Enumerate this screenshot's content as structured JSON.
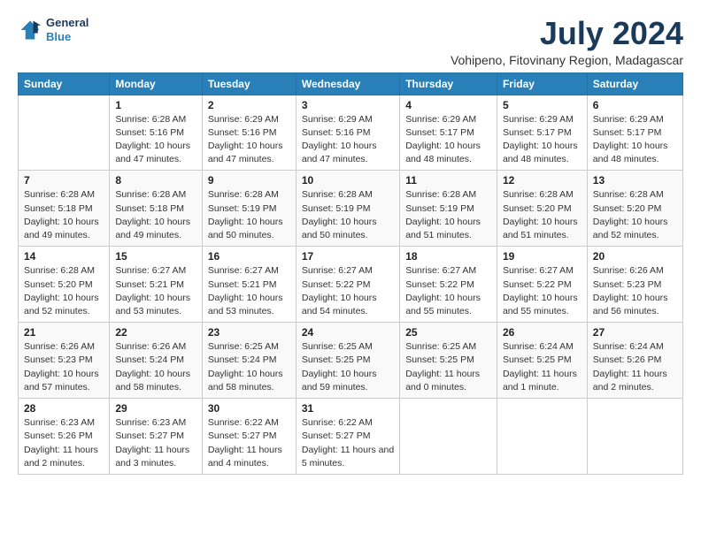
{
  "logo": {
    "line1": "General",
    "line2": "Blue"
  },
  "title": "July 2024",
  "subtitle": "Vohipeno, Fitovinany Region, Madagascar",
  "header_days": [
    "Sunday",
    "Monday",
    "Tuesday",
    "Wednesday",
    "Thursday",
    "Friday",
    "Saturday"
  ],
  "weeks": [
    [
      {
        "day": "",
        "sunrise": "",
        "sunset": "",
        "daylight": ""
      },
      {
        "day": "1",
        "sunrise": "Sunrise: 6:28 AM",
        "sunset": "Sunset: 5:16 PM",
        "daylight": "Daylight: 10 hours and 47 minutes."
      },
      {
        "day": "2",
        "sunrise": "Sunrise: 6:29 AM",
        "sunset": "Sunset: 5:16 PM",
        "daylight": "Daylight: 10 hours and 47 minutes."
      },
      {
        "day": "3",
        "sunrise": "Sunrise: 6:29 AM",
        "sunset": "Sunset: 5:16 PM",
        "daylight": "Daylight: 10 hours and 47 minutes."
      },
      {
        "day": "4",
        "sunrise": "Sunrise: 6:29 AM",
        "sunset": "Sunset: 5:17 PM",
        "daylight": "Daylight: 10 hours and 48 minutes."
      },
      {
        "day": "5",
        "sunrise": "Sunrise: 6:29 AM",
        "sunset": "Sunset: 5:17 PM",
        "daylight": "Daylight: 10 hours and 48 minutes."
      },
      {
        "day": "6",
        "sunrise": "Sunrise: 6:29 AM",
        "sunset": "Sunset: 5:17 PM",
        "daylight": "Daylight: 10 hours and 48 minutes."
      }
    ],
    [
      {
        "day": "7",
        "sunrise": "Sunrise: 6:28 AM",
        "sunset": "Sunset: 5:18 PM",
        "daylight": "Daylight: 10 hours and 49 minutes."
      },
      {
        "day": "8",
        "sunrise": "Sunrise: 6:28 AM",
        "sunset": "Sunset: 5:18 PM",
        "daylight": "Daylight: 10 hours and 49 minutes."
      },
      {
        "day": "9",
        "sunrise": "Sunrise: 6:28 AM",
        "sunset": "Sunset: 5:19 PM",
        "daylight": "Daylight: 10 hours and 50 minutes."
      },
      {
        "day": "10",
        "sunrise": "Sunrise: 6:28 AM",
        "sunset": "Sunset: 5:19 PM",
        "daylight": "Daylight: 10 hours and 50 minutes."
      },
      {
        "day": "11",
        "sunrise": "Sunrise: 6:28 AM",
        "sunset": "Sunset: 5:19 PM",
        "daylight": "Daylight: 10 hours and 51 minutes."
      },
      {
        "day": "12",
        "sunrise": "Sunrise: 6:28 AM",
        "sunset": "Sunset: 5:20 PM",
        "daylight": "Daylight: 10 hours and 51 minutes."
      },
      {
        "day": "13",
        "sunrise": "Sunrise: 6:28 AM",
        "sunset": "Sunset: 5:20 PM",
        "daylight": "Daylight: 10 hours and 52 minutes."
      }
    ],
    [
      {
        "day": "14",
        "sunrise": "Sunrise: 6:28 AM",
        "sunset": "Sunset: 5:20 PM",
        "daylight": "Daylight: 10 hours and 52 minutes."
      },
      {
        "day": "15",
        "sunrise": "Sunrise: 6:27 AM",
        "sunset": "Sunset: 5:21 PM",
        "daylight": "Daylight: 10 hours and 53 minutes."
      },
      {
        "day": "16",
        "sunrise": "Sunrise: 6:27 AM",
        "sunset": "Sunset: 5:21 PM",
        "daylight": "Daylight: 10 hours and 53 minutes."
      },
      {
        "day": "17",
        "sunrise": "Sunrise: 6:27 AM",
        "sunset": "Sunset: 5:22 PM",
        "daylight": "Daylight: 10 hours and 54 minutes."
      },
      {
        "day": "18",
        "sunrise": "Sunrise: 6:27 AM",
        "sunset": "Sunset: 5:22 PM",
        "daylight": "Daylight: 10 hours and 55 minutes."
      },
      {
        "day": "19",
        "sunrise": "Sunrise: 6:27 AM",
        "sunset": "Sunset: 5:22 PM",
        "daylight": "Daylight: 10 hours and 55 minutes."
      },
      {
        "day": "20",
        "sunrise": "Sunrise: 6:26 AM",
        "sunset": "Sunset: 5:23 PM",
        "daylight": "Daylight: 10 hours and 56 minutes."
      }
    ],
    [
      {
        "day": "21",
        "sunrise": "Sunrise: 6:26 AM",
        "sunset": "Sunset: 5:23 PM",
        "daylight": "Daylight: 10 hours and 57 minutes."
      },
      {
        "day": "22",
        "sunrise": "Sunrise: 6:26 AM",
        "sunset": "Sunset: 5:24 PM",
        "daylight": "Daylight: 10 hours and 58 minutes."
      },
      {
        "day": "23",
        "sunrise": "Sunrise: 6:25 AM",
        "sunset": "Sunset: 5:24 PM",
        "daylight": "Daylight: 10 hours and 58 minutes."
      },
      {
        "day": "24",
        "sunrise": "Sunrise: 6:25 AM",
        "sunset": "Sunset: 5:25 PM",
        "daylight": "Daylight: 10 hours and 59 minutes."
      },
      {
        "day": "25",
        "sunrise": "Sunrise: 6:25 AM",
        "sunset": "Sunset: 5:25 PM",
        "daylight": "Daylight: 11 hours and 0 minutes."
      },
      {
        "day": "26",
        "sunrise": "Sunrise: 6:24 AM",
        "sunset": "Sunset: 5:25 PM",
        "daylight": "Daylight: 11 hours and 1 minute."
      },
      {
        "day": "27",
        "sunrise": "Sunrise: 6:24 AM",
        "sunset": "Sunset: 5:26 PM",
        "daylight": "Daylight: 11 hours and 2 minutes."
      }
    ],
    [
      {
        "day": "28",
        "sunrise": "Sunrise: 6:23 AM",
        "sunset": "Sunset: 5:26 PM",
        "daylight": "Daylight: 11 hours and 2 minutes."
      },
      {
        "day": "29",
        "sunrise": "Sunrise: 6:23 AM",
        "sunset": "Sunset: 5:27 PM",
        "daylight": "Daylight: 11 hours and 3 minutes."
      },
      {
        "day": "30",
        "sunrise": "Sunrise: 6:22 AM",
        "sunset": "Sunset: 5:27 PM",
        "daylight": "Daylight: 11 hours and 4 minutes."
      },
      {
        "day": "31",
        "sunrise": "Sunrise: 6:22 AM",
        "sunset": "Sunset: 5:27 PM",
        "daylight": "Daylight: 11 hours and 5 minutes."
      },
      {
        "day": "",
        "sunrise": "",
        "sunset": "",
        "daylight": ""
      },
      {
        "day": "",
        "sunrise": "",
        "sunset": "",
        "daylight": ""
      },
      {
        "day": "",
        "sunrise": "",
        "sunset": "",
        "daylight": ""
      }
    ]
  ]
}
